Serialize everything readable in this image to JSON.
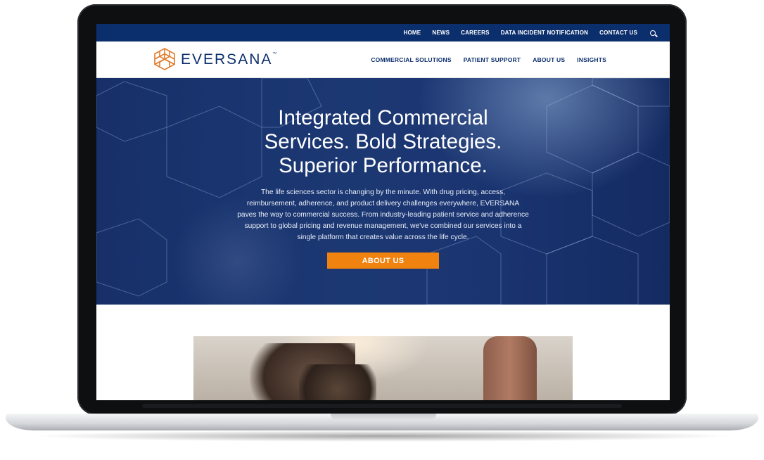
{
  "topbar": {
    "links": [
      "HOME",
      "NEWS",
      "CAREERS",
      "DATA INCIDENT NOTIFICATION",
      "CONTACT US"
    ],
    "search_icon": "search-icon"
  },
  "header": {
    "logo_text": "EVERSANA",
    "logo_tm": "™",
    "nav": [
      "COMMERCIAL SOLUTIONS",
      "PATIENT SUPPORT",
      "ABOUT US",
      "INSIGHTS"
    ]
  },
  "hero": {
    "title_lines": [
      "Integrated Commercial",
      "Services. Bold Strategies.",
      "Superior Performance."
    ],
    "body": "The life sciences sector is changing by the minute. With drug pricing, access, reimbursement, adherence, and product delivery challenges everywhere, EVERSANA paves the way to commercial success. From industry-leading patient service and adherence support to global pricing and revenue management, we've combined our services into a single platform that creates value across the life cycle.",
    "cta_label": "ABOUT US"
  },
  "colors": {
    "brand_navy": "#0b2f6d",
    "accent_orange": "#f0820f",
    "logo_orange": "#e07a2a"
  }
}
